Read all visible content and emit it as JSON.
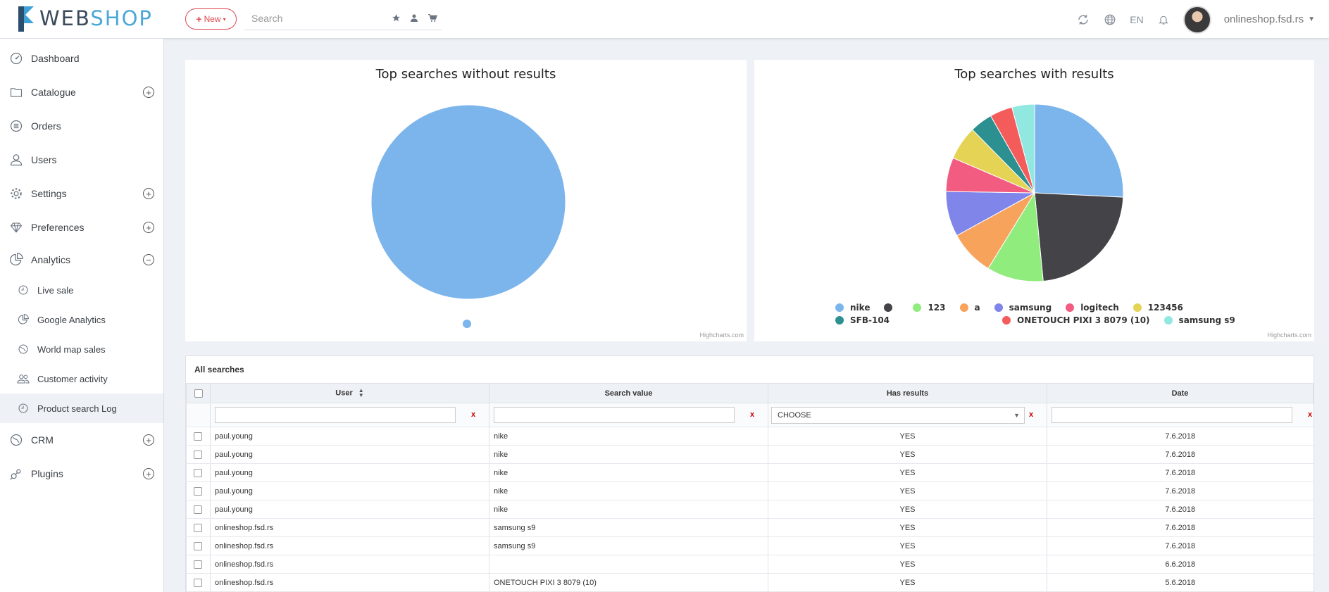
{
  "header": {
    "logo_web": "WEB",
    "logo_shop": "SHOP",
    "new_label": "New",
    "search_placeholder": "Search",
    "language": "EN",
    "user": "onlineshop.fsd.rs"
  },
  "sidebar": {
    "items": [
      {
        "label": "Dashboard",
        "icon": "dashboard-icon",
        "expandable": false
      },
      {
        "label": "Catalogue",
        "icon": "folder-icon",
        "expandable": true
      },
      {
        "label": "Orders",
        "icon": "list-icon",
        "expandable": false
      },
      {
        "label": "Users",
        "icon": "user-icon",
        "expandable": false
      },
      {
        "label": "Settings",
        "icon": "gear-icon",
        "expandable": true
      },
      {
        "label": "Preferences",
        "icon": "diamond-icon",
        "expandable": true
      },
      {
        "label": "Analytics",
        "icon": "pie-icon",
        "expandable": true
      }
    ],
    "analytics_sub": [
      {
        "label": "Live sale",
        "icon": "clock-icon"
      },
      {
        "label": "Google Analytics",
        "icon": "pie-icon"
      },
      {
        "label": "World map sales",
        "icon": "globe-icon"
      },
      {
        "label": "Customer activity",
        "icon": "users-icon"
      },
      {
        "label": "Product search Log",
        "icon": "clock-icon"
      }
    ],
    "bottom_items": [
      {
        "label": "CRM",
        "icon": "globe-icon"
      },
      {
        "label": "Plugins",
        "icon": "plugin-icon"
      }
    ]
  },
  "chart_data": [
    {
      "type": "pie",
      "title": "Top searches without results",
      "categories": [
        ""
      ],
      "values": [
        1
      ],
      "colors": [
        "#7cb5ec"
      ],
      "credit": "Highcharts.com"
    },
    {
      "type": "pie",
      "title": "Top searches with results",
      "categories": [
        "nike",
        "",
        "123",
        "a",
        "samsung",
        "logitech",
        "123456",
        "SFB-104",
        "ONETOUCH PIXI 3 8079 (10)",
        "samsung s9"
      ],
      "values": [
        25,
        22,
        10,
        8,
        8,
        6,
        6,
        4,
        4,
        4
      ],
      "colors": [
        "#7cb5ec",
        "#434348",
        "#90ed7d",
        "#f7a35c",
        "#8085e9",
        "#f15c80",
        "#e4d354",
        "#2b908f",
        "#f45b5b",
        "#91e8e1"
      ],
      "credit": "Highcharts.com"
    }
  ],
  "table": {
    "title": "All searches",
    "columns": [
      "User",
      "Search value",
      "Has results",
      "Date"
    ],
    "filter_select": "CHOOSE",
    "clear_label": "x",
    "rows": [
      [
        "paul.young",
        "nike",
        "YES",
        "7.6.2018"
      ],
      [
        "paul.young",
        "nike",
        "YES",
        "7.6.2018"
      ],
      [
        "paul.young",
        "nike",
        "YES",
        "7.6.2018"
      ],
      [
        "paul.young",
        "nike",
        "YES",
        "7.6.2018"
      ],
      [
        "paul.young",
        "nike",
        "YES",
        "7.6.2018"
      ],
      [
        "onlineshop.fsd.rs",
        "samsung s9",
        "YES",
        "7.6.2018"
      ],
      [
        "onlineshop.fsd.rs",
        "samsung s9",
        "YES",
        "7.6.2018"
      ],
      [
        "onlineshop.fsd.rs",
        "",
        "YES",
        "6.6.2018"
      ],
      [
        "onlineshop.fsd.rs",
        "ONETOUCH PIXI 3 8079 (10)",
        "YES",
        "5.6.2018"
      ]
    ]
  }
}
